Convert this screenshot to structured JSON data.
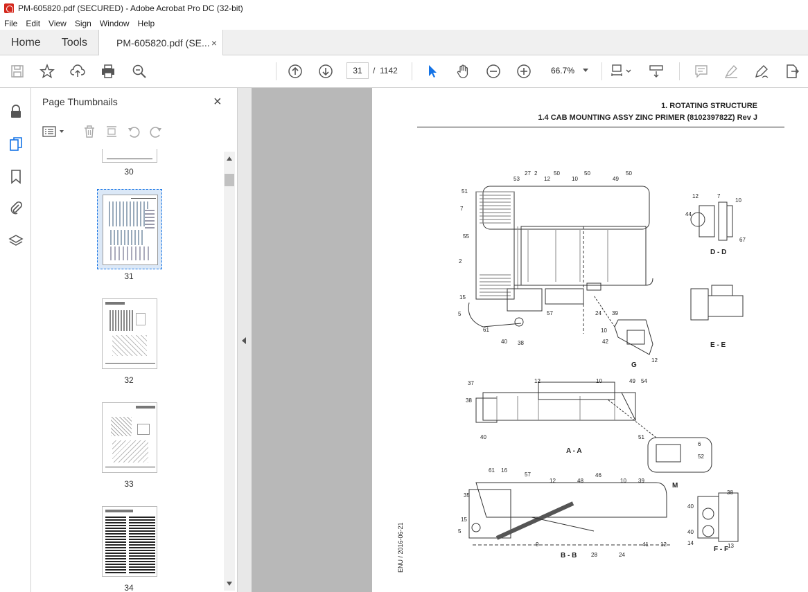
{
  "window": {
    "title": "PM-605820.pdf (SECURED) - Adobe Acrobat Pro DC (32-bit)"
  },
  "menu": [
    "File",
    "Edit",
    "View",
    "Sign",
    "Window",
    "Help"
  ],
  "tabs": {
    "home": "Home",
    "tools": "Tools",
    "document": "PM-605820.pdf (SE...",
    "close": "×"
  },
  "toolbar": {
    "page_current": "31",
    "page_separator": "/",
    "page_total": "1142",
    "zoom": "66.7%"
  },
  "sidebar": {
    "title": "Page Thumbnails",
    "close": "×",
    "thumbnails": [
      {
        "label": "30"
      },
      {
        "label": "31"
      },
      {
        "label": "32"
      },
      {
        "label": "33"
      },
      {
        "label": "34"
      }
    ]
  },
  "page": {
    "heading1": "1. ROTATING STRUCTURE",
    "heading2": "1.4 CAB MOUNTING ASSY ZINC PRIMER (810239782Z) Rev J",
    "footer": "ENU / 2016-06-21",
    "views": [
      {
        "label": "D - D"
      },
      {
        "label": "E - E"
      },
      {
        "label": "G"
      },
      {
        "label": "A - A"
      },
      {
        "label": "M"
      },
      {
        "label": "B - B"
      },
      {
        "label": "F - F"
      }
    ]
  },
  "colors": {
    "accent": "#1473e6",
    "panel_bg": "#f0f0f0",
    "doc_bg": "#b8b8b8"
  }
}
